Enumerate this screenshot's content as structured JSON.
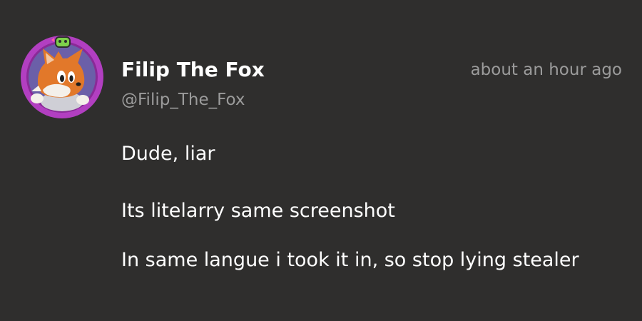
{
  "post": {
    "author": {
      "display_name": "Filip The Fox",
      "handle": "@Filip_The_Fox",
      "avatar_icon": "fox-character-avatar-icon",
      "avatar_ring_color": "#b23fc1"
    },
    "timestamp": "about an hour ago",
    "paragraphs": [
      "Dude, liar",
      "Its litelarry same screenshot",
      "In same langue i took it in, so stop lying stealer"
    ]
  },
  "colors": {
    "background": "#2f2e2d",
    "text_primary": "#ffffff",
    "text_secondary": "#9b9b9b"
  }
}
